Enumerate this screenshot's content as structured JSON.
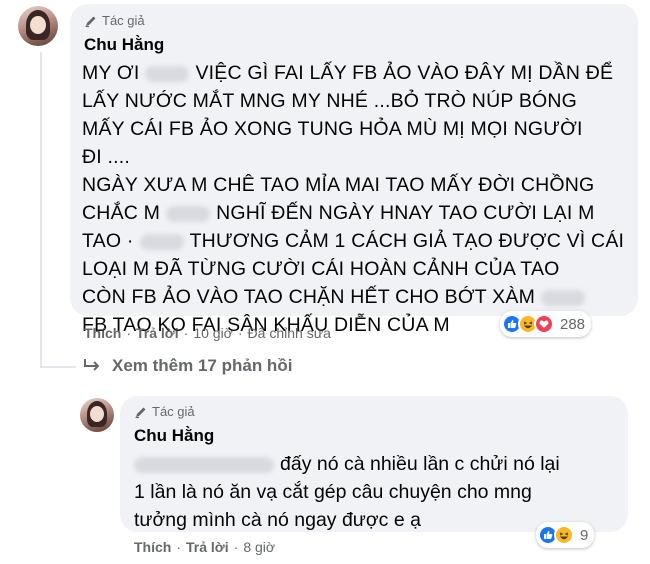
{
  "comment1": {
    "badge": "Tác giả",
    "author": "Chu Hằng",
    "lines": [
      [
        "MY ƠI",
        "VIỆC GÌ FAI LẤY FB ẢO VÀO ĐÂY MỊ DẦN ĐỂ"
      ],
      [
        "LẤY NƯỚC MẮT MNG MY NHÉ ...BỎ TRÒ NÚP BÓNG"
      ],
      [
        "MẤY CÁI FB ẢO XONG TUNG HỎA MÙ MỊ MỌI NGƯỜI"
      ],
      [
        "ĐI ...."
      ],
      [
        "NGÀY XƯA M CHÊ TAO MỈA MAI TAO MẤY ĐỜI CHỒNG"
      ],
      [
        "CHẮC M",
        "NGHĨ ĐẾN NGÀY HNAY TAO CƯỜI LẠI M"
      ],
      [
        "TAO ·",
        "THƯƠNG CẢM 1 CÁCH GIẢ TẠO ĐƯỢC VÌ CÁI"
      ],
      [
        "LOẠI M ĐÃ TỪNG CƯỜI CÁI HOÀN CẢNH CỦA TAO"
      ],
      [
        "CÒN FB ẢO VÀO TAO CHẶN HẾT CHO BỚT XÀM"
      ],
      [
        "FB TAO KO FAI SÂN KHẤU DIỄN CỦA M"
      ]
    ],
    "actions": {
      "like": "Thích",
      "reply": "Trả lời",
      "time": "10 giờ",
      "edited": "Đã chỉnh sửa"
    },
    "reaction_count": "288"
  },
  "more_replies": "Xem thêm 17 phản hồi",
  "comment2": {
    "badge": "Tác giả",
    "author": "Chu Hằng",
    "lines": [
      [
        "đấy nó cà nhiều lần c chửi nó lại"
      ],
      [
        "1 lần là nó ăn vạ cắt gép câu chuyện cho mng"
      ],
      [
        "tưởng mình cà nó ngay được e ạ"
      ]
    ],
    "actions": {
      "like": "Thích",
      "reply": "Trả lời",
      "time": "8 giờ"
    },
    "reaction_count": "9"
  },
  "colors": {
    "bubble": "#f0f2f5",
    "secondary_text": "#65676b",
    "like": "#1877f2",
    "haha": "#f7b928",
    "love": "#f33e58"
  },
  "icons": [
    "author-pen-icon",
    "reply-arrow-icon",
    "like-reaction-icon",
    "haha-reaction-icon",
    "love-reaction-icon"
  ]
}
